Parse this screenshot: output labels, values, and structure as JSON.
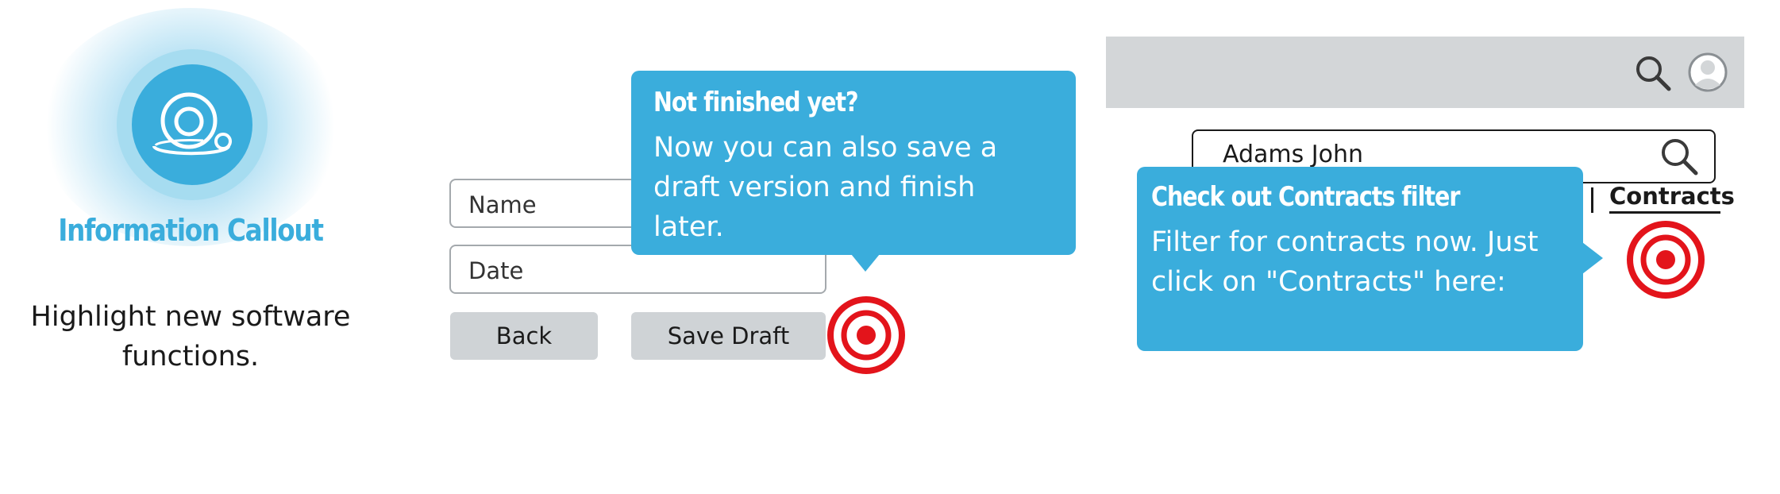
{
  "feature": {
    "title": "Information Callout",
    "description": "Highlight new software functions.",
    "icon": "information-callout-icon"
  },
  "form_demo": {
    "name_placeholder": "Name",
    "date_placeholder": "Date",
    "back_label": "Back",
    "save_draft_label": "Save Draft",
    "callout": {
      "title": "Not finished yet?",
      "body": "Now you can also save a draft version and finish later."
    },
    "target_icon": "target-icon"
  },
  "app_demo": {
    "search_value": "Adams John",
    "tab_contracts_label": "Contracts",
    "topbar_icons": [
      "search-icon",
      "user-icon"
    ],
    "callout": {
      "title": "Check out Contracts filter",
      "body": "Filter for contracts now. Just click on \"Contracts\" here:"
    },
    "target_icon": "target-icon"
  },
  "colors": {
    "accent": "#3aaddc",
    "glow": "#a6dcf0",
    "target_red": "#e3141b",
    "button_gray": "#cfd3d6",
    "topbar_gray": "#d3d6d8"
  }
}
